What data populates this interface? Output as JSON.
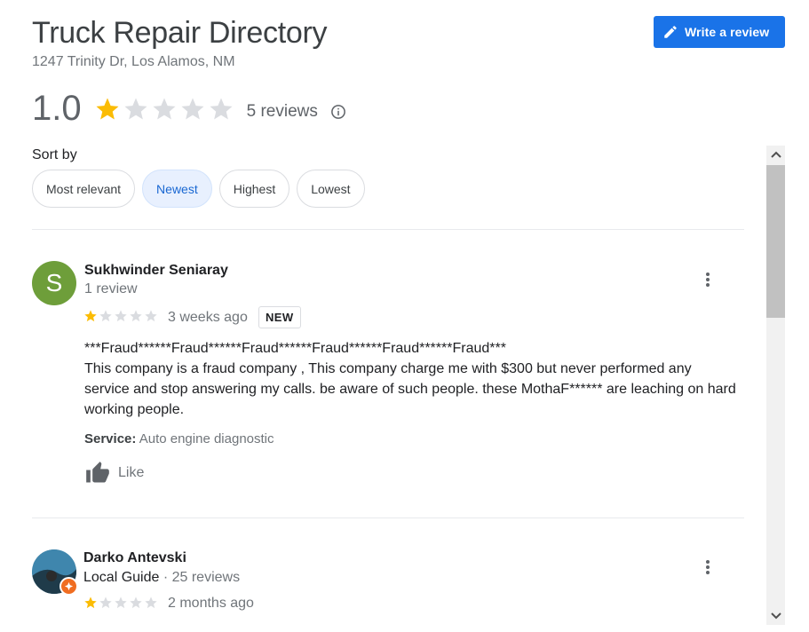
{
  "header": {
    "title": "Truck Repair Directory",
    "address": "1247 Trinity Dr, Los Alamos, NM",
    "write_review_label": "Write a review"
  },
  "summary": {
    "rating": "1.0",
    "rating_value": 1,
    "max_stars": 5,
    "reviews_count": "5 reviews"
  },
  "sort": {
    "label": "Sort by",
    "options": [
      "Most relevant",
      "Newest",
      "Highest",
      "Lowest"
    ],
    "selected": "Newest"
  },
  "reviews": [
    {
      "name": "Sukhwinder Seniaray",
      "avatar_letter": "S",
      "avatar_color": "#6e9e3a",
      "subtitle": "1 review",
      "stars": 1,
      "time": "3 weeks ago",
      "badge": "NEW",
      "text_line1": "***Fraud******Fraud******Fraud******Fraud******Fraud******Fraud***",
      "text_body": "This company is a fraud company , This company charge me with $300 but never performed any service and  stop answering  my calls. be aware of such people. these MothaF****** are leaching on hard working people.",
      "service_label": "Service:",
      "service_value": "Auto engine diagnostic",
      "like_label": "Like"
    },
    {
      "name": "Darko Antevski",
      "subtitle_guide": "Local Guide",
      "subtitle_reviews": " · 25 reviews",
      "stars": 1,
      "time": "2 months ago"
    }
  ],
  "colors": {
    "accent": "#1a73e8",
    "star_filled": "#fbbc04",
    "star_empty": "#dadce0"
  }
}
